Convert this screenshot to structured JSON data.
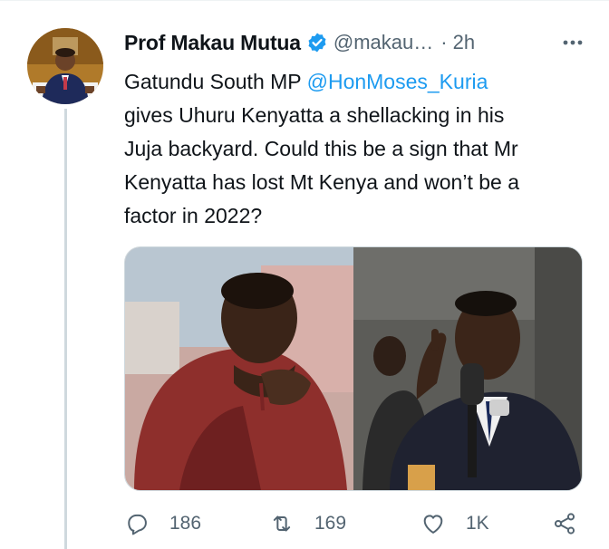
{
  "tweet": {
    "author": {
      "display_name": "Prof Makau Mutua",
      "handle": "@makau…",
      "verified": true
    },
    "separator": "·",
    "time": "2h",
    "more_icon": "more-dots-icon",
    "text": {
      "line1_prefix": "Gatundu South MP ",
      "mention": "@HonMoses_Kuria",
      "line2": " gives Uhuru Kenyatta a shellacking in his",
      "line3": "Juja backyard.  Could this be a sign that Mr",
      "line4": "Kenyatta has lost Mt Kenya and won’t be a",
      "line5": "factor in 2022?"
    },
    "media": {
      "photos": [
        {
          "icon": "photo-man-in-red-shirt"
        },
        {
          "icon": "photo-man-speaking-at-microphone"
        }
      ]
    },
    "actions": {
      "reply": {
        "icon": "reply-icon",
        "count": "186"
      },
      "retweet": {
        "icon": "retweet-icon",
        "count": "169"
      },
      "like": {
        "icon": "heart-icon",
        "count": "1K"
      },
      "share": {
        "icon": "share-icon"
      }
    }
  },
  "colors": {
    "accent": "#1d9bf0",
    "text": "#0f1419",
    "secondary": "#536471",
    "border": "#cfd9de",
    "thread_line": "#cfd9de"
  }
}
